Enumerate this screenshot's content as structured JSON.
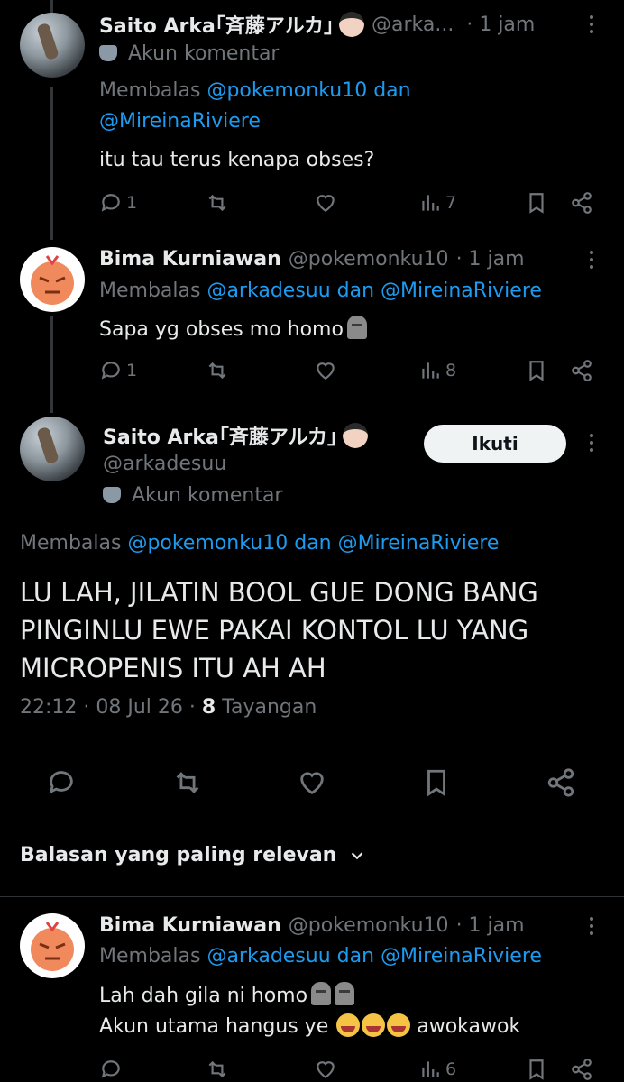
{
  "reply1": {
    "name": "Saito Arka｢斉藤アルカ｣",
    "handle": "@arka...",
    "time": "· 1 jam",
    "account_label": "Akun komentar",
    "replying_prefix": "Membalas",
    "replying_a": "@pokemonku10 dan",
    "replying_b": "@MireinaRiviere",
    "text": "itu tau terus kenapa obses?",
    "replies": "1",
    "views": "7"
  },
  "reply2": {
    "name": "Bima Kurniawan",
    "handle": "@pokemonku10",
    "time": "· 1 jam",
    "replying_prefix": "Membalas",
    "replying_a": "@arkadesuu dan @MireinaRiviere",
    "text": "Sapa yg obses mo homo",
    "replies": "1",
    "views": "8"
  },
  "main": {
    "name": "Saito Arka｢斉藤アルカ｣",
    "handle": "@arkadesuu",
    "account_label": "Akun komentar",
    "follow_label": "Ikuti",
    "replying_prefix": "Membalas",
    "replying_a": "@pokemonku10 dan @MireinaRiviere",
    "text": "LU LAH, JILATIN BOOL GUE DONG BANG PINGINLU EWE PAKAI KONTOL LU YANG MICROPENIS ITU AH AH",
    "timestamp": "22:12 · 08 Jul 26 ·",
    "views_count": "8",
    "views_label": "Tayangan"
  },
  "sort_label": "Balasan yang paling relevan",
  "reply3": {
    "name": "Bima Kurniawan",
    "handle": "@pokemonku10",
    "time": "· 1 jam",
    "replying_prefix": "Membalas",
    "replying_a": "@arkadesuu dan @MireinaRiviere",
    "text_line1": "Lah dah gila ni homo",
    "text_line2": "Akun utama hangus ye",
    "text_line2_tail": "awokawok",
    "views": "6"
  },
  "colors": {
    "background": "#000000",
    "text": "#e7e9ea",
    "muted": "#71767b",
    "link": "#1d9bf0"
  }
}
